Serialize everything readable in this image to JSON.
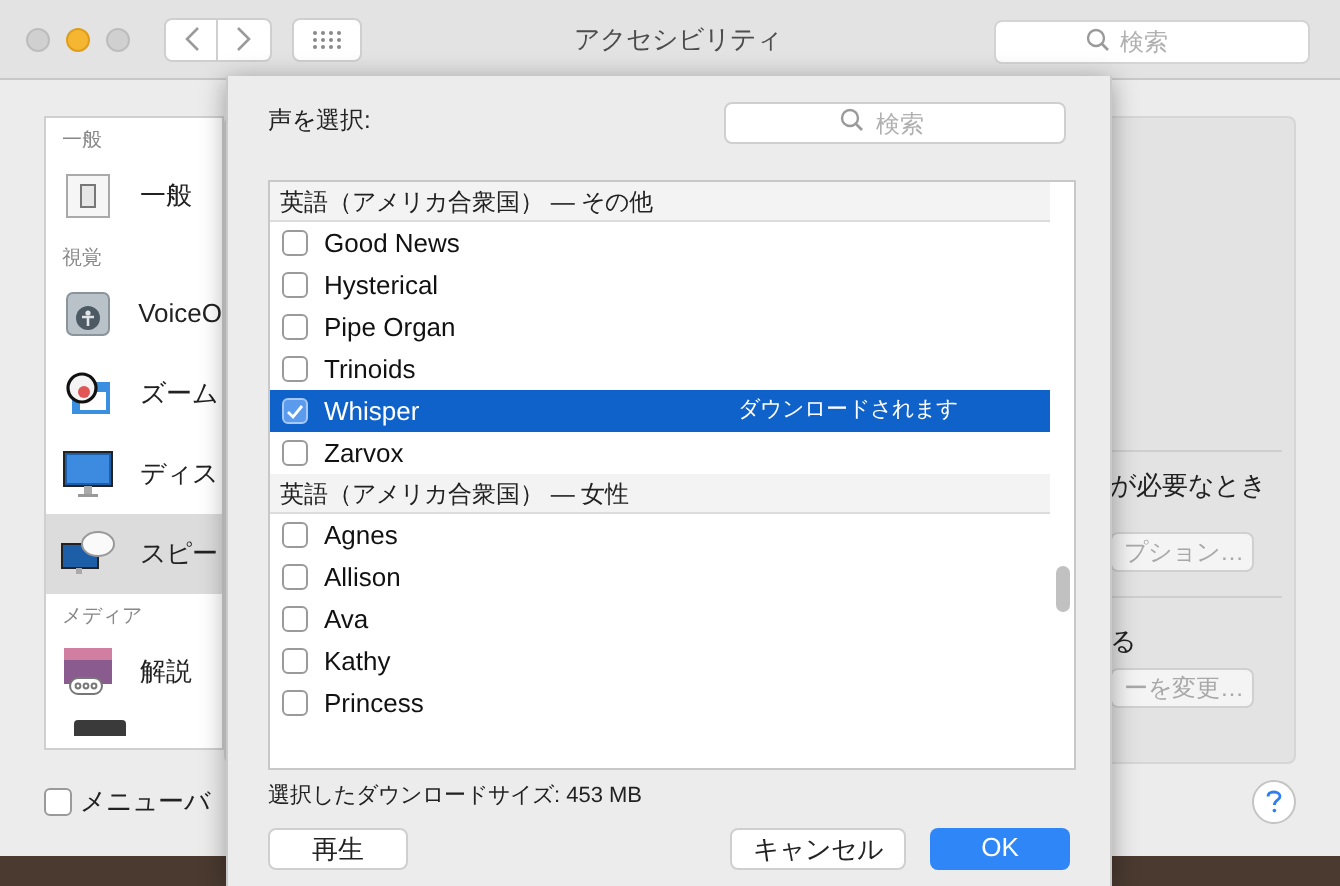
{
  "window": {
    "title": "アクセシビリティ",
    "search_placeholder": "検索"
  },
  "sidebar": {
    "sections": [
      {
        "label": "一般",
        "items": [
          {
            "label": "一般",
            "kind": "switch",
            "selected": false
          }
        ]
      },
      {
        "label": "視覚",
        "items": [
          {
            "label": "VoiceO",
            "kind": "voiceover",
            "selected": false
          },
          {
            "label": "ズーム",
            "kind": "zoom",
            "selected": false
          },
          {
            "label": "ディス",
            "kind": "display",
            "selected": false
          },
          {
            "label": "スピー",
            "kind": "speech",
            "selected": true
          }
        ]
      },
      {
        "label": "メディア",
        "items": [
          {
            "label": "解説",
            "kind": "description",
            "selected": false
          }
        ]
      }
    ]
  },
  "right_panel": {
    "line_1": "が必要なとき",
    "button_1": "プション…",
    "line_2": "る",
    "button_2": "ーを変更…"
  },
  "menu_bar_checkbox": {
    "label": "メニューバ",
    "checked": false
  },
  "dialog": {
    "label": "声を選択:",
    "search_placeholder": "検索",
    "groups": [
      {
        "header": "英語（アメリカ合衆国） — その他",
        "voices": [
          {
            "name": "Good News",
            "checked": false,
            "selected": false
          },
          {
            "name": "Hysterical",
            "checked": false,
            "selected": false
          },
          {
            "name": "Pipe Organ",
            "checked": false,
            "selected": false
          },
          {
            "name": "Trinoids",
            "checked": false,
            "selected": false
          },
          {
            "name": "Whisper",
            "checked": true,
            "selected": true,
            "status": "ダウンロードされます"
          },
          {
            "name": "Zarvox",
            "checked": false,
            "selected": false
          }
        ]
      },
      {
        "header": "英語（アメリカ合衆国） — 女性",
        "voices": [
          {
            "name": "Agnes",
            "checked": false,
            "selected": false
          },
          {
            "name": "Allison",
            "checked": false,
            "selected": false
          },
          {
            "name": "Ava",
            "checked": false,
            "selected": false
          },
          {
            "name": "Kathy",
            "checked": false,
            "selected": false
          },
          {
            "name": "Princess",
            "checked": false,
            "selected": false
          }
        ]
      }
    ],
    "download_size": "選択したダウンロードサイズ: 453 MB",
    "buttons": [
      {
        "label": "再生",
        "kind": "normal"
      },
      {
        "label": "キャンセル",
        "kind": "normal"
      },
      {
        "label": "OK",
        "kind": "default"
      }
    ]
  }
}
